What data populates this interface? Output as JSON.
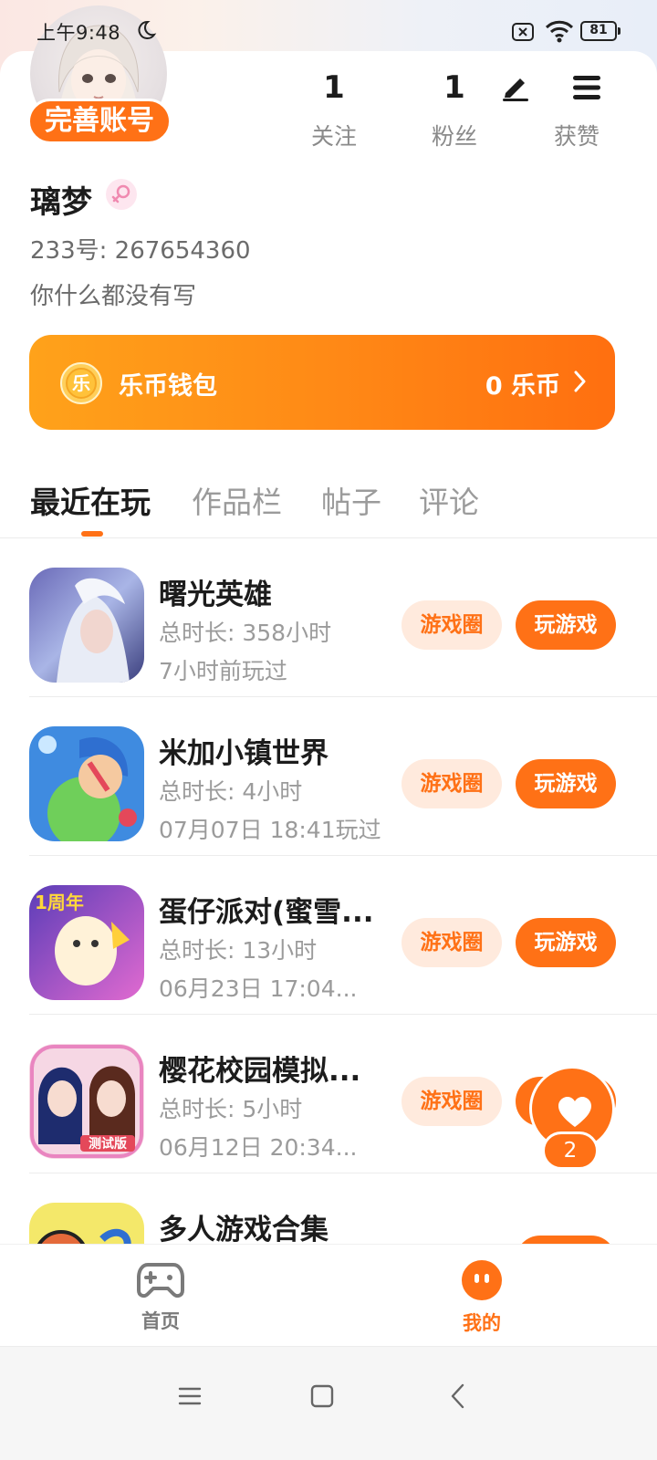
{
  "status_bar": {
    "time": "上午9:48",
    "battery": "81"
  },
  "profile": {
    "complete_account_label": "完善账号",
    "username": "璃梦",
    "user_id": "233号: 267654360",
    "bio": "你什么都没有写",
    "stats": [
      {
        "value": "1",
        "label": "关注"
      },
      {
        "value": "1",
        "label": "粉丝"
      },
      {
        "value": "",
        "label": "获赞"
      }
    ]
  },
  "wallet": {
    "title": "乐币钱包",
    "balance": "0 乐币",
    "coin_glyph": "乐"
  },
  "tabs": [
    {
      "label": "最近在玩",
      "active": true
    },
    {
      "label": "作品栏",
      "active": false
    },
    {
      "label": "帖子",
      "active": false
    },
    {
      "label": "评论",
      "active": false
    }
  ],
  "games": [
    {
      "name": "曙光英雄",
      "duration": "总时长: 358小时",
      "last_played": "7小时前玩过",
      "circle_label": "游戏圈",
      "play_label": "玩游戏"
    },
    {
      "name": "米加小镇世界",
      "duration": "总时长: 4小时",
      "last_played": "07月07日 18:41玩过",
      "circle_label": "游戏圈",
      "play_label": "玩游戏"
    },
    {
      "name": "蛋仔派对(蜜雪...",
      "duration": "总时长: 13小时",
      "last_played": "06月23日 17:04...",
      "circle_label": "游戏圈",
      "play_label": "玩游戏"
    },
    {
      "name": "樱花校园模拟...",
      "duration": "总时长: 5小时",
      "last_played": "06月12日 20:34...",
      "circle_label": "游戏圈",
      "play_label": "玩游戏"
    },
    {
      "name": "多人游戏合集",
      "duration": "",
      "last_played": "",
      "circle_label": "",
      "play_label": ""
    }
  ],
  "game_icon_texts": {
    "anniversary": "1周年",
    "test_version": "测试版"
  },
  "like_fab": {
    "count": "2"
  },
  "bottom_nav": [
    {
      "label": "首页",
      "icon": "gamepad-icon",
      "active": false
    },
    {
      "label": "我的",
      "icon": "smiley-icon",
      "active": true
    }
  ],
  "colors": {
    "accent": "#ff7116",
    "accent_light": "#ffeadd",
    "text_primary": "#1c1c1c",
    "text_secondary": "#9b9b9b"
  }
}
